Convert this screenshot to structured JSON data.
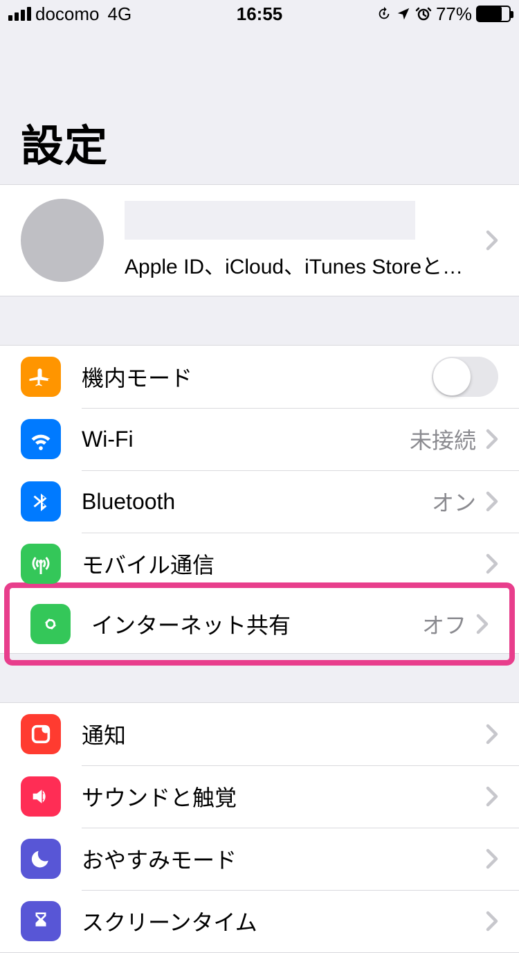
{
  "status_bar": {
    "carrier": "docomo",
    "network_type": "4G",
    "time": "16:55",
    "battery_percent": "77%"
  },
  "header": {
    "title": "設定"
  },
  "profile": {
    "subtitle": "Apple ID、iCloud、iTunes StoreとApp S..."
  },
  "rows": {
    "airplane": {
      "label": "機内モード",
      "toggle": "off"
    },
    "wifi": {
      "label": "Wi-Fi",
      "value": "未接続"
    },
    "bluetooth": {
      "label": "Bluetooth",
      "value": "オン"
    },
    "cellular": {
      "label": "モバイル通信"
    },
    "hotspot": {
      "label": "インターネット共有",
      "value": "オフ"
    },
    "notifications": {
      "label": "通知"
    },
    "sounds": {
      "label": "サウンドと触覚"
    },
    "dnd": {
      "label": "おやすみモード"
    },
    "screentime": {
      "label": "スクリーンタイム"
    }
  }
}
